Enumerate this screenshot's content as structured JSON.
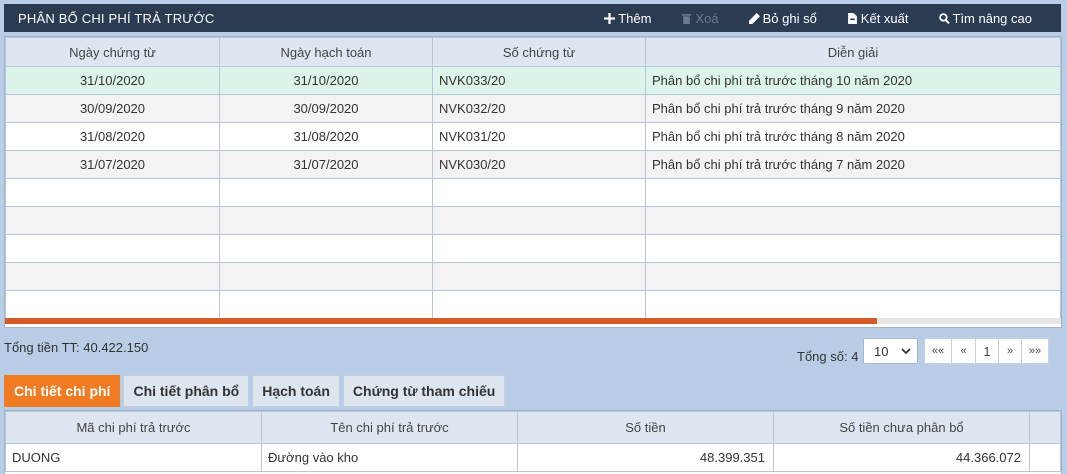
{
  "header": {
    "title": "PHÂN BỔ CHI PHÍ TRẢ TRƯỚC",
    "buttons": {
      "add": "Thêm",
      "delete": "Xoá",
      "unpost": "Bỏ ghi sổ",
      "export": "Kết xuất",
      "search": "Tìm nâng cao"
    }
  },
  "main_grid": {
    "columns": [
      "Ngày chứng từ",
      "Ngày hạch toán",
      "Số chứng từ",
      "Diễn giải"
    ],
    "rows": [
      [
        "31/10/2020",
        "31/10/2020",
        "NVK033/20",
        "Phân bổ chi phí trả trước tháng 10 năm 2020"
      ],
      [
        "30/09/2020",
        "30/09/2020",
        "NVK032/20",
        "Phân bổ chi phí trả trước tháng 9 năm 2020"
      ],
      [
        "31/08/2020",
        "31/08/2020",
        "NVK031/20",
        "Phân bổ chi phí trả trước tháng 8 năm 2020"
      ],
      [
        "31/07/2020",
        "31/07/2020",
        "NVK030/20",
        "Phân bổ chi phí trả trước tháng 7 năm 2020"
      ]
    ],
    "selected_row": 0
  },
  "summary": {
    "total_label": "Tổng tiền TT: 40.422.150",
    "count_label": "Tổng số: 4",
    "page_size": "10"
  },
  "pager": {
    "first": "««",
    "prev": "«",
    "page": "1",
    "next": "»",
    "last": "»»"
  },
  "tabs": [
    "Chi tiết chi phí",
    "Chi tiết phân bổ",
    "Hạch toán",
    "Chứng từ tham chiếu"
  ],
  "detail_grid": {
    "columns": [
      "Mã chi phí trả trước",
      "Tên chi phí trả trước",
      "Số tiền",
      "Số tiền chưa phân bổ"
    ],
    "rows": [
      [
        "DUONG",
        "Đường vào kho",
        "48.399.351",
        "44.366.072"
      ]
    ]
  },
  "colors": {
    "header_bg": "#2b3c52",
    "accent": "#f07b22",
    "selected_row": "#ddf4ea",
    "scrollbar": "#d45a26"
  }
}
